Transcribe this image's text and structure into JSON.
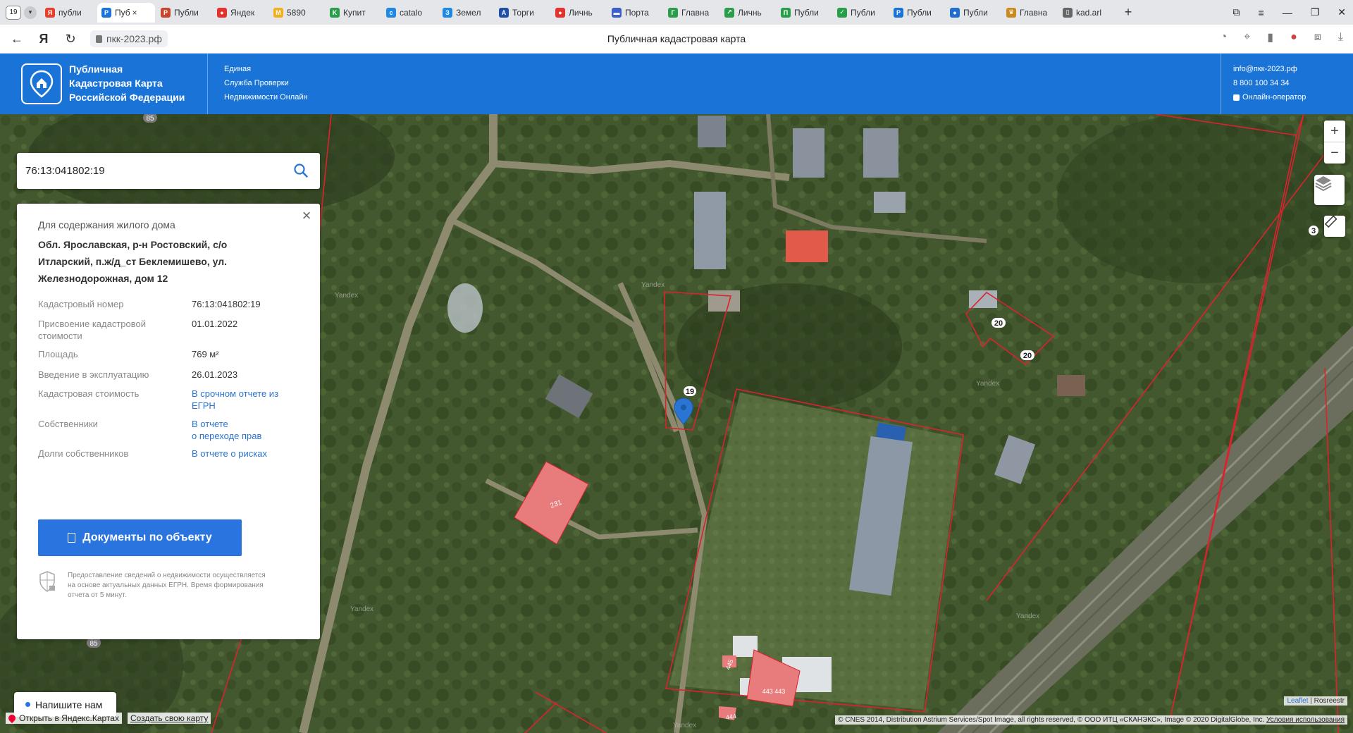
{
  "browser": {
    "tab_count": "19",
    "tabs": [
      {
        "label": "публи",
        "icon": "yandex-icon",
        "color": "#e8402a",
        "glyph": "Я"
      },
      {
        "label": "Пуб",
        "icon": "pkk-icon",
        "color": "#1a74d8",
        "glyph": "P",
        "active": true
      },
      {
        "label": "Публи",
        "icon": "rosreestr-icon",
        "color": "#c8462e",
        "glyph": "Р"
      },
      {
        "label": "Яндек",
        "icon": "maps-pin-icon",
        "color": "#e5322d",
        "glyph": "●"
      },
      {
        "label": "5890",
        "icon": "mail-icon",
        "color": "#f2b01e",
        "glyph": "M"
      },
      {
        "label": "Купит",
        "icon": "green-shield-icon",
        "color": "#2a9d4a",
        "glyph": "K"
      },
      {
        "label": "catalo",
        "icon": "catalog-icon",
        "color": "#1e88e5",
        "glyph": "c"
      },
      {
        "label": "Земел",
        "icon": "land-icon",
        "color": "#1e88e5",
        "glyph": "З"
      },
      {
        "label": "Торги",
        "icon": "torgi-icon",
        "color": "#1f4fa8",
        "glyph": "A"
      },
      {
        "label": "Личнь",
        "icon": "gosuslugi-icon",
        "color": "#e5322d",
        "glyph": "●"
      },
      {
        "label": "Порта",
        "icon": "flag-icon",
        "color": "#3a5fc8",
        "glyph": "▬"
      },
      {
        "label": "Главна",
        "icon": "emblem-icon",
        "color": "#2a9d4a",
        "glyph": "Г"
      },
      {
        "label": "Личнь",
        "icon": "arrow-icon",
        "color": "#2a9d4a",
        "glyph": "↗"
      },
      {
        "label": "Публи",
        "icon": "emblem-icon",
        "color": "#2a9d4a",
        "glyph": "П"
      },
      {
        "label": "Публи",
        "icon": "check-icon",
        "color": "#2a9d4a",
        "glyph": "✓"
      },
      {
        "label": "Публи",
        "icon": "pkk-icon",
        "color": "#1a74d8",
        "glyph": "P"
      },
      {
        "label": "Публи",
        "icon": "globe-icon",
        "color": "#1e6fd0",
        "glyph": "●"
      },
      {
        "label": "Главна",
        "icon": "eagle-icon",
        "color": "#c98a1e",
        "glyph": "♛"
      },
      {
        "label": "kad.arl",
        "icon": "doc-icon",
        "color": "#666666",
        "glyph": "▯"
      }
    ],
    "url": "пкк-2023.рф",
    "page_title": "Публичная кадастровая карта"
  },
  "header": {
    "brand_lines": [
      "Публичная",
      "Кадастровая Карта",
      "Российской Федерации"
    ],
    "service_lines": [
      "Единая",
      "Служба Проверки",
      "Недвижимости Онлайн"
    ],
    "email": "info@пкк-2023.рф",
    "phone": "8 800 100 34 34",
    "operator": "Онлайн-оператор"
  },
  "search": {
    "value": "76:13:041802:19"
  },
  "card": {
    "purpose": "Для содержания жилого дома",
    "address": "Обл. Ярославская, р-н Ростовский, с/о Итларский, п.ж/д_ст Беклемишево, ул. Железнодорожная, дом 12",
    "rows": [
      {
        "key": "Кадастровый номер",
        "value": "76:13:041802:19",
        "link": false
      },
      {
        "key": "Присвоение кадастровой стоимости",
        "value": "01.01.2022",
        "link": false
      },
      {
        "key": "Площадь",
        "value": "769 м²",
        "link": false
      },
      {
        "key": "Введение в эксплуатацию",
        "value": "26.01.2023",
        "link": false
      },
      {
        "key": "Кадастровая стоимость",
        "value": "В срочном отчете из ЕГРН",
        "link": true
      },
      {
        "key": "Собственники",
        "value": "В отчете\nо переходе прав",
        "link": true
      },
      {
        "key": "Долги собственников",
        "value": "В отчете о рисках",
        "link": true
      }
    ],
    "docs_button": "Документы по объекту",
    "note": "Предоставление сведений о недвижимости осуществляется на основе актуальных данных ЕГРН. Время формирования отчета от 5 минут."
  },
  "map": {
    "parcel_labels": [
      "19",
      "20",
      "20",
      "231",
      "443 443",
      "444",
      "445",
      "3"
    ],
    "road_labels": [
      "85",
      "85"
    ],
    "watermark": "Yandex",
    "chat_label": "Напишите нам",
    "open_in_maps": "Открыть в Яндекс.Картах",
    "create_map": "Создать свою карту",
    "leaflet": "Leaflet",
    "attribution_sep": " | ",
    "rosreestr": "Rosreestr",
    "copyright": "© CNES 2014, Distribution Astrium Services/Spot Image, all rights reserved, © ООО ИТЦ «СКАНЭКС», Image © 2020 DigitalGlobe, Inc.",
    "terms": "Условия использования",
    "zoom_in": "+",
    "zoom_out": "−"
  },
  "colors": {
    "brand_blue": "#1a74d8",
    "button_blue": "#2a74e0",
    "parcel_red": "#d9232e",
    "building_fill": "#e87c7c",
    "link_blue": "#2a74d4"
  }
}
